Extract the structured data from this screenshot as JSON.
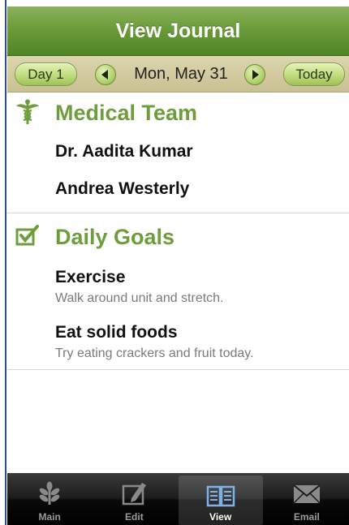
{
  "header": {
    "title": "View Journal"
  },
  "datebar": {
    "day_button": "Day 1",
    "date": "Mon, May 31",
    "today_button": "Today"
  },
  "medical_team": {
    "title": "Medical Team",
    "icon": "caduceus-icon",
    "members": [
      "Dr. Aadita Kumar",
      "Andrea Westerly"
    ]
  },
  "daily_goals": {
    "title": "Daily Goals",
    "icon": "checkbox-icon",
    "goals": [
      {
        "title": "Exercise",
        "desc": "Walk around unit and stretch."
      },
      {
        "title": "Eat solid foods",
        "desc": "Try eating crackers and fruit today."
      }
    ]
  },
  "tabbar": {
    "tabs": [
      {
        "label": "Main",
        "icon": "plant-icon"
      },
      {
        "label": "Edit",
        "icon": "edit-icon"
      },
      {
        "label": "View",
        "icon": "book-icon"
      },
      {
        "label": "Email",
        "icon": "envelope-icon"
      }
    ],
    "active": "View"
  },
  "colors": {
    "accent_green": "#6e9e3c",
    "header_green": "#5f9130",
    "datebar_tan": "#d3cba0",
    "tab_active_icon": "#7fb0e8"
  }
}
